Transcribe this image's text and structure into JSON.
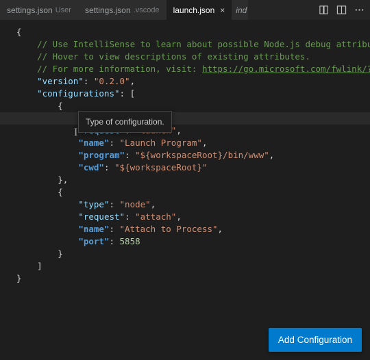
{
  "tabs": [
    {
      "title": "settings.json",
      "subtitle": "User"
    },
    {
      "title": "settings.json",
      "subtitle": ".vscode"
    },
    {
      "title": "launch.json",
      "subtitle": ""
    },
    {
      "title": "ind",
      "subtitle": ""
    }
  ],
  "tooltip": "Type of configuration.",
  "button": "Add Configuration",
  "code": {
    "c1": "// Use IntelliSense to learn about possible Node.js debug attributes",
    "c2": "// Hover to view descriptions of existing attributes.",
    "c3a": "// For more information, visit: ",
    "c3b": "https://go.microsoft.com/fwlink/?li",
    "versionKey": "\"version\"",
    "versionVal": "\"0.2.0\"",
    "confKey": "\"configurations\"",
    "typeKey": "\"type\"",
    "nodeVal": "\"node\"",
    "requestKey": "\"request\"",
    "launchVal": "\"launch\"",
    "nameKey": "\"name\"",
    "launchProg": "\"Launch Program\"",
    "programKey": "\"program\"",
    "programVal": "\"${workspaceRoot}/bin/www\"",
    "cwdKey": "\"cwd\"",
    "cwdVal": "\"${workspaceRoot}\"",
    "attachVal": "\"attach\"",
    "attachProc": "\"Attach to Process\"",
    "portKey": "\"port\"",
    "portVal": "5858"
  }
}
